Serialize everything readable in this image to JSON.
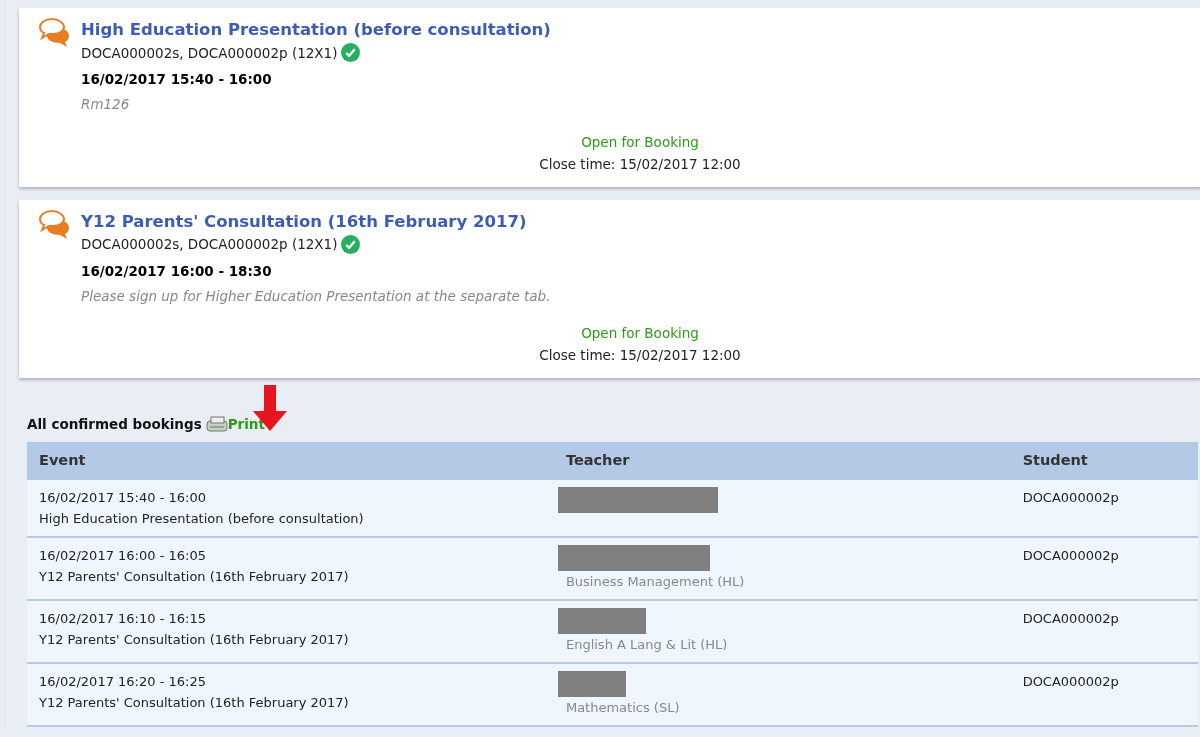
{
  "events": [
    {
      "title": "High Education Presentation (before consultation)",
      "students": "DOCA000002s, DOCA000002p (12X1)",
      "confirmed": true,
      "time": "16/02/2017 15:40 - 16:00",
      "note": "Rm126",
      "status": "Open for Booking",
      "close_time": "Close time: 15/02/2017 12:00"
    },
    {
      "title": "Y12 Parents' Consultation (16th February 2017)",
      "students": "DOCA000002s, DOCA000002p (12X1)",
      "confirmed": true,
      "time": "16/02/2017 16:00 - 18:30",
      "note": "Please sign up for Higher Education Presentation at the separate tab.",
      "status": "Open for Booking",
      "close_time": "Close time: 15/02/2017 12:00"
    }
  ],
  "bookings": {
    "heading": "All confirmed bookings",
    "print_link": "Print",
    "columns": [
      "Event",
      "Teacher",
      "Student"
    ],
    "rows": [
      {
        "time": "16/02/2017 15:40 - 16:00",
        "event": "High Education Presentation (before consultation)",
        "teacher_redacted": true,
        "student": "DOCA000002p"
      },
      {
        "time": "16/02/2017 16:00 - 16:05",
        "event": "Y12 Parents' Consultation (16th February 2017)",
        "teacher_redacted": true,
        "subject": "Business Management (HL)",
        "student": "DOCA000002p"
      },
      {
        "time": "16/02/2017 16:10 - 16:15",
        "event": "Y12 Parents' Consultation (16th February 2017)",
        "teacher_redacted": true,
        "subject": "English A Lang & Lit (HL)",
        "student": "DOCA000002p"
      },
      {
        "time": "16/02/2017 16:20 - 16:25",
        "event": "Y12 Parents' Consultation (16th February 2017)",
        "teacher_redacted": true,
        "subject": "Mathematics (SL)",
        "student": "DOCA000002p"
      }
    ]
  }
}
